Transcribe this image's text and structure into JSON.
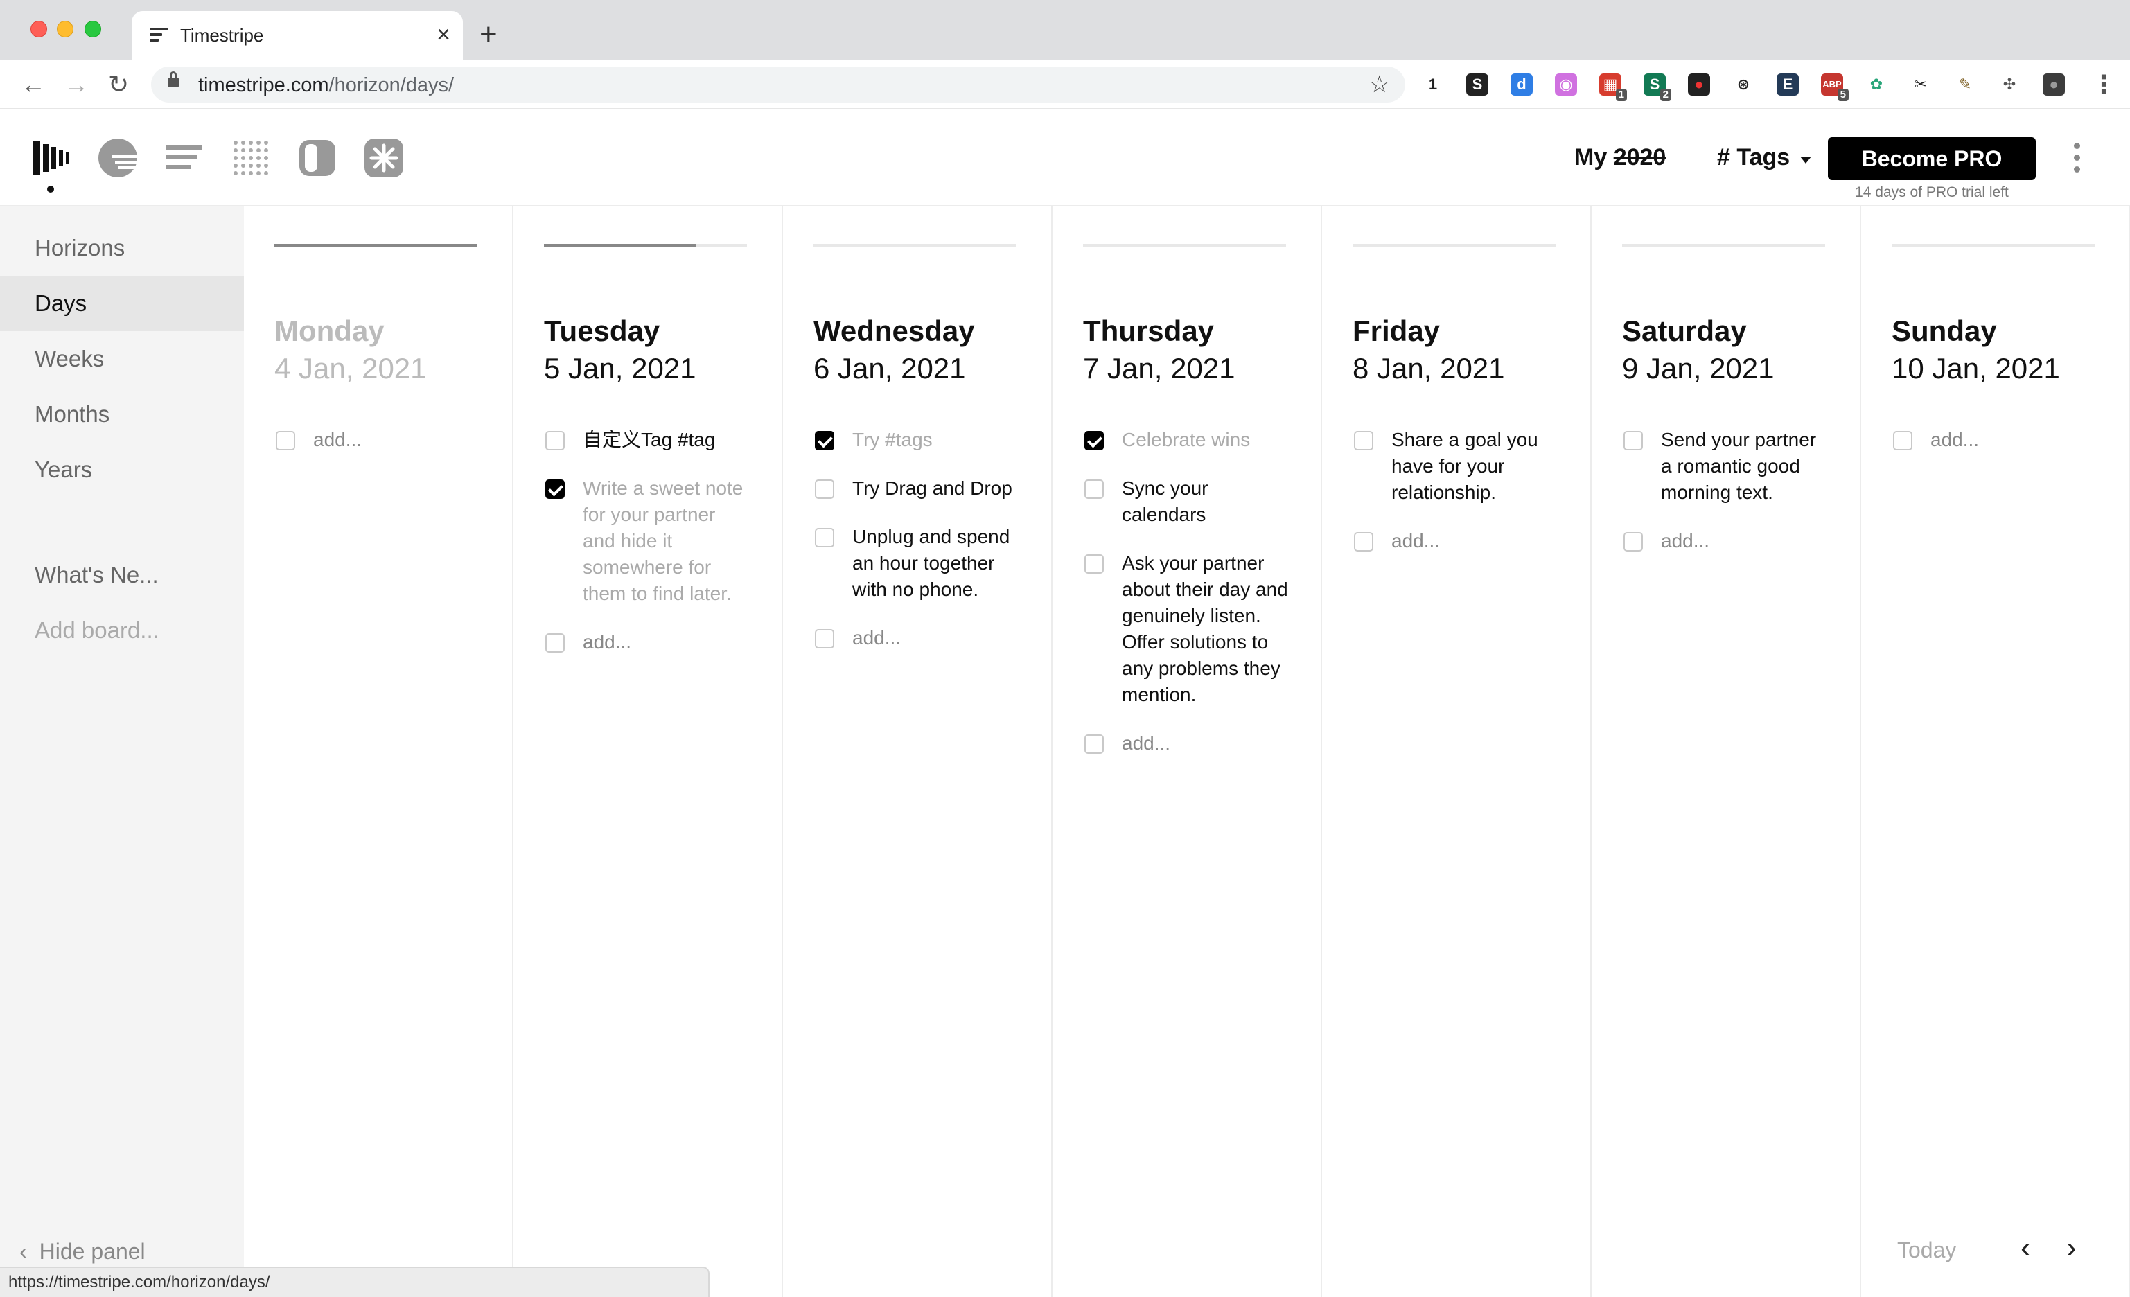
{
  "browser": {
    "tab_title": "Timestripe",
    "tab_close": "×",
    "new_tab": "+",
    "url_host": "timestripe.com",
    "url_path": "/horizon/days/",
    "status_url": "https://timestripe.com/horizon/days/",
    "extensions": [
      {
        "icon": "1-password-icon",
        "text": "1",
        "color": "#ffffff",
        "textColor": "#222222",
        "badge": ""
      },
      {
        "icon": "s-extension-icon",
        "text": "S",
        "color": "#222222",
        "textColor": "#ffffff",
        "badge": ""
      },
      {
        "icon": "d-extension-icon",
        "text": "d",
        "color": "#2f7ee5",
        "textColor": "#ffffff",
        "badge": ""
      },
      {
        "icon": "purple-circle-icon",
        "text": "◉",
        "color": "#d071e0",
        "textColor": "#ffffff",
        "badge": ""
      },
      {
        "icon": "calendar-extension-icon",
        "text": "▦",
        "color": "#d73c2e",
        "textColor": "#ffffff",
        "badge": "1"
      },
      {
        "icon": "s-green-extension-icon",
        "text": "S",
        "color": "#127a54",
        "textColor": "#ffffff",
        "badge": "2"
      },
      {
        "icon": "red-dot-extension-icon",
        "text": "●",
        "color": "#222222",
        "textColor": "#e33",
        "badge": ""
      },
      {
        "icon": "aperture-icon",
        "text": "⊛",
        "color": "#ffffff",
        "textColor": "#222222",
        "badge": ""
      },
      {
        "icon": "e-extension-icon",
        "text": "E",
        "color": "#233a57",
        "textColor": "#ffffff",
        "badge": ""
      },
      {
        "icon": "abp-icon",
        "text": "ABP",
        "color": "#c5362f",
        "textColor": "#ffffff",
        "badge": "5"
      },
      {
        "icon": "green-leaf-icon",
        "text": "✿",
        "color": "#ffffff",
        "textColor": "#2aa67a",
        "badge": ""
      },
      {
        "icon": "scissors-icon",
        "text": "✂",
        "color": "#ffffff",
        "textColor": "#222222",
        "badge": ""
      },
      {
        "icon": "pencil-extension-icon",
        "text": "✎",
        "color": "#ffffff",
        "textColor": "#7a5b1d",
        "badge": ""
      },
      {
        "icon": "puzzle-icon",
        "text": "✣",
        "color": "#ffffff",
        "textColor": "#555555",
        "badge": ""
      },
      {
        "icon": "profile-avatar-icon",
        "text": "●",
        "color": "#3c3c3c",
        "textColor": "#9a9a9a",
        "badge": ""
      }
    ],
    "menu_icon": "⋮"
  },
  "header": {
    "my_label": "My",
    "year_struck": "2020",
    "tags_label": "# Tags",
    "pro_button": "Become PRO",
    "trial_text": "14 days of PRO trial left"
  },
  "sidebar": {
    "items": [
      {
        "label": "Horizons",
        "active": false,
        "muted": false
      },
      {
        "label": "Days",
        "active": true,
        "muted": false
      },
      {
        "label": "Weeks",
        "active": false,
        "muted": false
      },
      {
        "label": "Months",
        "active": false,
        "muted": false
      },
      {
        "label": "Years",
        "active": false,
        "muted": false
      },
      {
        "label": "What's Ne...",
        "active": false,
        "muted": false
      },
      {
        "label": "Add board...",
        "active": false,
        "muted": true
      }
    ],
    "hide_panel": "Hide panel"
  },
  "days": [
    {
      "name": "Monday",
      "date": "4 Jan, 2021",
      "progress": 1.0,
      "past": true,
      "tasks": [],
      "add": "add..."
    },
    {
      "name": "Tuesday",
      "date": "5 Jan, 2021",
      "progress": 0.75,
      "past": false,
      "tasks": [
        {
          "text": "自定义Tag #tag",
          "done": false
        },
        {
          "text": "Write a sweet note for your partner and hide it somewhere for them to find later.",
          "done": true
        }
      ],
      "add": "add..."
    },
    {
      "name": "Wednesday",
      "date": "6 Jan, 2021",
      "progress": 0,
      "past": false,
      "tasks": [
        {
          "text": "Try #tags",
          "done": true
        },
        {
          "text": "Try Drag and Drop",
          "done": false
        },
        {
          "text": "Unplug and spend an hour together with no phone.",
          "done": false
        }
      ],
      "add": "add..."
    },
    {
      "name": "Thursday",
      "date": "7 Jan, 2021",
      "progress": 0,
      "past": false,
      "tasks": [
        {
          "text": "Celebrate wins",
          "done": true
        },
        {
          "text": "Sync your calendars",
          "done": false
        },
        {
          "text": "Ask your partner about their day and genuinely listen. Offer solutions to any problems they mention.",
          "done": false
        }
      ],
      "add": "add..."
    },
    {
      "name": "Friday",
      "date": "8 Jan, 2021",
      "progress": 0,
      "past": false,
      "tasks": [
        {
          "text": "Share a goal you have for your relationship.",
          "done": false
        }
      ],
      "add": "add..."
    },
    {
      "name": "Saturday",
      "date": "9 Jan, 2021",
      "progress": 0,
      "past": false,
      "tasks": [
        {
          "text": "Send your partner a romantic good morning text.",
          "done": false
        }
      ],
      "add": "add..."
    },
    {
      "name": "Sunday",
      "date": "10 Jan, 2021",
      "progress": 0,
      "past": false,
      "tasks": [],
      "add": "add..."
    }
  ],
  "footer": {
    "today": "Today",
    "prev": "‹",
    "next": "›"
  },
  "colors": {
    "accent": "#000000",
    "sidebar_bg": "#f4f4f4",
    "sidebar_active": "#e6e6e6"
  }
}
